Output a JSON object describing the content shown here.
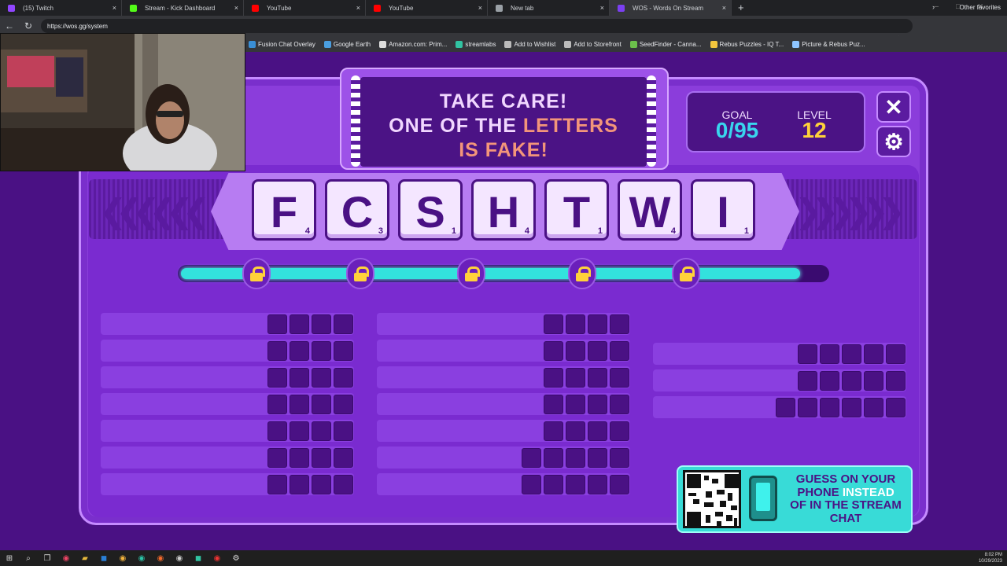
{
  "browser": {
    "tabs": [
      {
        "title": "(15) Twitch",
        "color": "#9146ff"
      },
      {
        "title": "Stream - Kick Dashboard",
        "color": "#53fc18"
      },
      {
        "title": "YouTube",
        "color": "#ff0000"
      },
      {
        "title": "YouTube",
        "color": "#ff0000"
      },
      {
        "title": "New tab",
        "color": "#9aa0a6"
      },
      {
        "title": "WOS - Words On Stream",
        "color": "#7b3ff2"
      }
    ],
    "url": "https://wos.gg/system",
    "bookmarks": [
      "Fusion Chat Overlay",
      "Google Earth",
      "Amazon.com: Prim...",
      "streamlabs",
      "Add to Wishlist",
      "Add to Storefront",
      "SeedFinder - Canna...",
      "Rebus Puzzles - IQ T...",
      "Picture & Rebus Puz..."
    ],
    "other_favorites": "Other favorites"
  },
  "game": {
    "banner": {
      "line1": "TAKE CARE!",
      "line2a": "ONE OF THE ",
      "line2b": "LETTERS",
      "line3": "IS FAKE!"
    },
    "goal_label": "GOAL",
    "goal_value": "0/95",
    "level_label": "LEVEL",
    "level_value": "12",
    "close_icon": "close-icon",
    "settings_icon": "gear-icon",
    "tiles": [
      {
        "letter": "F",
        "points": "4"
      },
      {
        "letter": "C",
        "points": "3"
      },
      {
        "letter": "S",
        "points": "1"
      },
      {
        "letter": "H",
        "points": "4"
      },
      {
        "letter": "T",
        "points": "1"
      },
      {
        "letter": "W",
        "points": "4"
      },
      {
        "letter": "I",
        "points": "1"
      }
    ],
    "progress": 0.96,
    "columns": [
      {
        "rows": [
          4,
          4,
          4,
          4,
          4,
          4,
          4
        ]
      },
      {
        "rows": [
          4,
          4,
          4,
          4,
          4,
          5,
          5
        ]
      },
      {
        "rows": [
          5,
          5,
          6
        ]
      }
    ],
    "phone": {
      "l1": "GUESS ON YOUR",
      "l2a": "PHONE ",
      "l2b": "INSTEAD",
      "l3": "OF IN THE STREAM",
      "l4": "CHAT"
    }
  },
  "taskbar": {
    "time": "8:02 PM",
    "date": "10/29/2023"
  }
}
